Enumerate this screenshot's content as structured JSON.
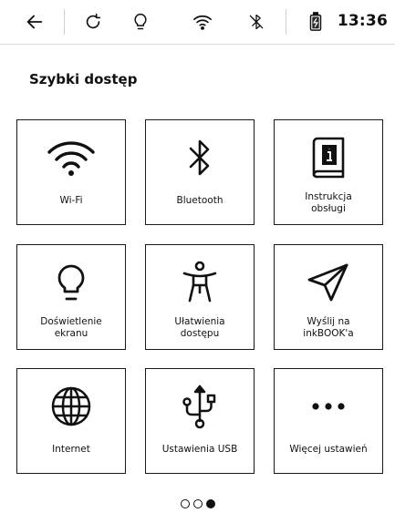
{
  "statusbar": {
    "clock": "13:36",
    "icons": [
      "back-arrow-icon",
      "refresh-icon",
      "lightbulb-icon",
      "wifi-icon",
      "bluetooth-off-icon",
      "battery-charging-icon"
    ]
  },
  "section": {
    "title": "Szybki dostęp"
  },
  "tiles": [
    {
      "label": "Wi-Fi",
      "icon": "wifi-icon"
    },
    {
      "label": "Bluetooth",
      "icon": "bluetooth-icon"
    },
    {
      "label": "Instrukcja\nobsługi",
      "icon": "manual-book-icon"
    },
    {
      "label": "Doświetlenie\nekranu",
      "icon": "lightbulb-icon"
    },
    {
      "label": "Ułatwienia\ndostępu",
      "icon": "accessibility-icon"
    },
    {
      "label": "Wyślij na\ninkBOOK'a",
      "icon": "send-icon"
    },
    {
      "label": "Internet",
      "icon": "globe-icon"
    },
    {
      "label": "Ustawienia USB",
      "icon": "usb-icon"
    },
    {
      "label": "Więcej ustawień",
      "icon": "more-dots-icon"
    }
  ],
  "pager": {
    "pages": 3,
    "current": 3
  }
}
